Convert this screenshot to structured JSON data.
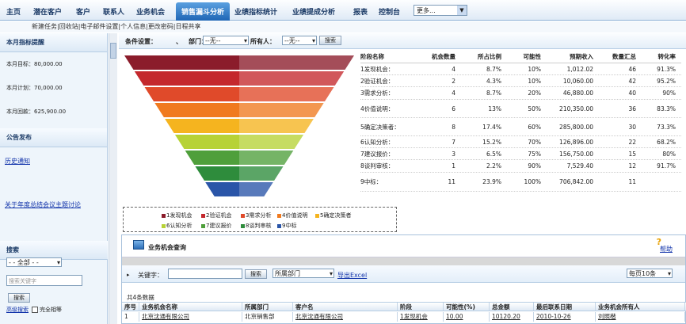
{
  "nav": {
    "items": [
      "主页",
      "潜在客户",
      "客户",
      "联系人",
      "业务机会",
      "销售漏斗分析",
      "业绩指标统计",
      "业绩提成分析",
      "报表",
      "控制台"
    ],
    "active": 5,
    "more": "更多..."
  },
  "subnav": "新建任务|回收站|电子邮件设置|个人信息|更改密码|日程共享",
  "left": {
    "target_title": "本月指标提醒",
    "target": "本月目标：80,000.00",
    "plan": "本月计划：70,000.00",
    "paid": "本月回款：625,900.00",
    "notice_title": "公告发布",
    "notice1": "历史通知",
    "notice2": "关于年度总结会议主题讨论",
    "search_title": "搜索",
    "search_scope": "- - 全部 - -",
    "search_placeholder": "搜索关键字",
    "search_btn": "搜索",
    "adv_search": "高级搜索",
    "exact_match": "完全相等"
  },
  "cond": {
    "label": "条件设置：",
    "dept_label": "部门：",
    "dept_value": "--无--",
    "owner_label": "所有人：",
    "owner_value": "--无--",
    "search_btn": "搜索"
  },
  "table": {
    "headers": [
      "阶段名称",
      "机会数量",
      "所占比例",
      "可能性",
      "预期收入",
      "数量汇总",
      "转化率"
    ],
    "rows": [
      [
        "1发现机会：",
        "4",
        "8.7%",
        "10%",
        "1,012.02",
        "46",
        "91.3%"
      ],
      [
        "2验证机会：",
        "2",
        "4.3%",
        "10%",
        "10,060.00",
        "42",
        "95.2%"
      ],
      [
        "3需求分析：",
        "4",
        "8.7%",
        "20%",
        "46,880.00",
        "40",
        "90%"
      ],
      [
        "4价值说明：",
        "6",
        "13%",
        "50%",
        "210,350.00",
        "36",
        "83.3%"
      ],
      [
        "5确定决策者：",
        "8",
        "17.4%",
        "60%",
        "285,800.00",
        "30",
        "73.3%"
      ],
      [
        "6认知分析：",
        "7",
        "15.2%",
        "70%",
        "126,896.00",
        "22",
        "68.2%"
      ],
      [
        "7建议报价：",
        "3",
        "6.5%",
        "75%",
        "156,750.00",
        "15",
        "80%"
      ],
      [
        "8谈判审核：",
        "1",
        "2.2%",
        "90%",
        "7,529.40",
        "12",
        "91.7%"
      ],
      [
        "9中标：",
        "11",
        "23.9%",
        "100%",
        "706,842.00",
        "11",
        ""
      ]
    ]
  },
  "funnel_colors": [
    "#8b1c2b",
    "#c4282d",
    "#e04a2a",
    "#f07a1f",
    "#f5b41f",
    "#b7d236",
    "#4f9f3b",
    "#2e8c3c",
    "#2a55a8"
  ],
  "legend": [
    "1发现机会",
    "2验证机会",
    "3需求分析",
    "4价值说明",
    "5确定决策者",
    "6认知分析",
    "7建议报价",
    "8谈判审核",
    "9中标"
  ],
  "panel": {
    "title": "业务机会查询",
    "help": "帮助",
    "keyword_label": "关键字：",
    "search_btn": "搜索",
    "dept": "所属部门",
    "export": "导出Excel",
    "pagesize": "每页10条",
    "count": "共4条数据",
    "columns": [
      "序号",
      "业务机会名称",
      "所属部门",
      "客户名",
      "阶段",
      "可能性(%)",
      "总金额",
      "最后联系日期",
      "业务机会所有人"
    ],
    "row": [
      "1",
      "北京沈通有限公司",
      "北京销售部",
      "北京沈通有限公司",
      "1发现机会",
      "10.00",
      "10120.20",
      "2010-10-26",
      "刘照楷"
    ]
  }
}
